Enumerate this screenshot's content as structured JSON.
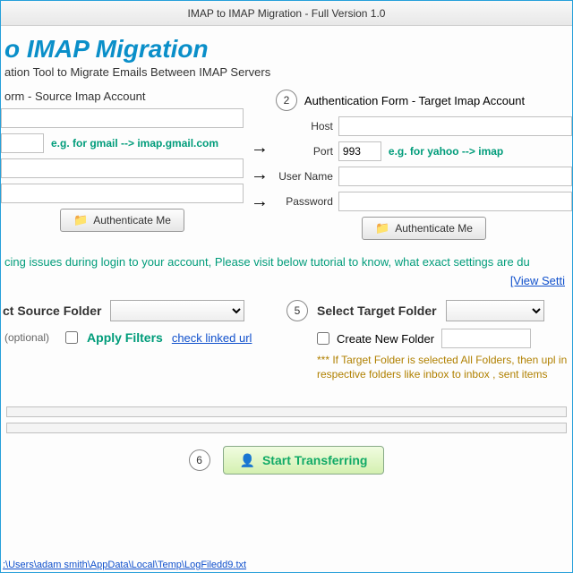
{
  "titlebar": "IMAP to IMAP Migration - Full Version 1.0",
  "header": {
    "title": "o IMAP Migration",
    "subtitle": "ation Tool to Migrate Emails Between IMAP Servers"
  },
  "source": {
    "panel_title": "orm - Source Imap Account",
    "host_label": "",
    "port_label": "",
    "port_value": "",
    "hint": "e.g. for gmail -->  imap.gmail.com",
    "user_label": "",
    "pass_label": "",
    "auth_btn": "Authenticate Me"
  },
  "target": {
    "step": "2",
    "panel_title": "Authentication Form - Target  Imap Account",
    "host_label": "Host",
    "port_label": "Port",
    "port_value": "993",
    "hint": "e.g. for yahoo --> imap",
    "user_label": "User Name",
    "pass_label": "Password",
    "auth_btn": "Authenticate Me"
  },
  "note": "cing issues during login to your account, Please visit below tutorial to know, what exact settings are du",
  "view_link": "[View Setti",
  "folder": {
    "src_title": "ct Source Folder",
    "tgt_step": "5",
    "tgt_title": "Select Target Folder",
    "optional": "(optional)",
    "apply": "Apply Filters",
    "check_link": "check linked url",
    "create_label": "Create New Folder",
    "warn": "*** If Target Folder is selected All Folders, then upl in respective folders like inbox to inbox , sent items"
  },
  "start": {
    "step": "6",
    "label": "Start Transferring"
  },
  "logpath": ":\\Users\\adam smith\\AppData\\Local\\Temp\\LogFiledd9.txt"
}
